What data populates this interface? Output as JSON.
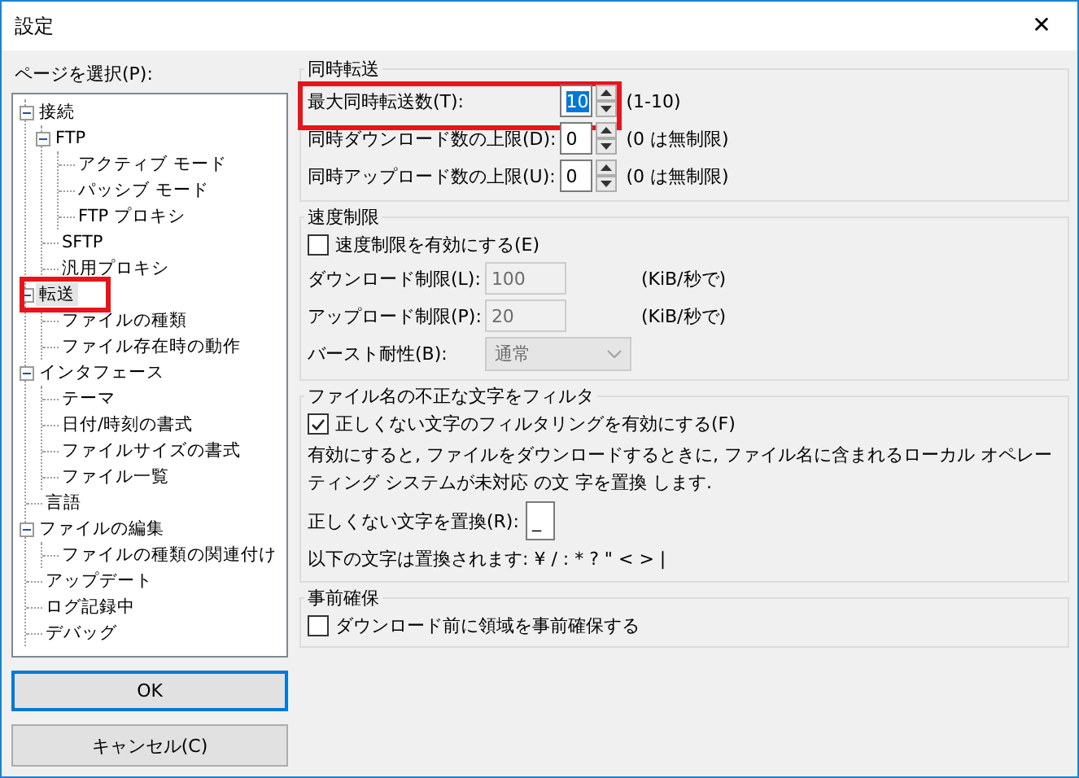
{
  "window": {
    "title": "設定",
    "close": "✕"
  },
  "sidebar": {
    "label": "ページを選択(P):",
    "tree": [
      {
        "label": "接続",
        "expanded": true,
        "selected": false,
        "highlighted": false,
        "children": [
          {
            "label": "FTP",
            "expanded": true,
            "selected": false,
            "highlighted": false,
            "children": [
              {
                "label": "アクティブ モード",
                "selected": false,
                "highlighted": false
              },
              {
                "label": "パッシブ モード",
                "selected": false,
                "highlighted": false
              },
              {
                "label": "FTP プロキシ",
                "selected": false,
                "highlighted": false
              }
            ]
          },
          {
            "label": "SFTP",
            "selected": false,
            "highlighted": false
          },
          {
            "label": "汎用プロキシ",
            "selected": false,
            "highlighted": false
          }
        ]
      },
      {
        "label": "転送",
        "expanded": true,
        "selected": true,
        "highlighted": true,
        "children": [
          {
            "label": "ファイルの種類",
            "selected": false,
            "highlighted": false
          },
          {
            "label": "ファイル存在時の動作",
            "selected": false,
            "highlighted": false
          }
        ]
      },
      {
        "label": "インタフェース",
        "expanded": true,
        "selected": false,
        "highlighted": false,
        "children": [
          {
            "label": "テーマ",
            "selected": false,
            "highlighted": false
          },
          {
            "label": "日付/時刻の書式",
            "selected": false,
            "highlighted": false
          },
          {
            "label": "ファイルサイズの書式",
            "selected": false,
            "highlighted": false
          },
          {
            "label": "ファイル一覧",
            "selected": false,
            "highlighted": false
          }
        ]
      },
      {
        "label": "言語",
        "selected": false,
        "highlighted": false
      },
      {
        "label": "ファイルの編集",
        "expanded": true,
        "selected": false,
        "highlighted": false,
        "children": [
          {
            "label": "ファイルの種類の関連付け",
            "selected": false,
            "highlighted": false
          }
        ]
      },
      {
        "label": "アップデート",
        "selected": false,
        "highlighted": false
      },
      {
        "label": "ログ記録中",
        "selected": false,
        "highlighted": false
      },
      {
        "label": "デバッグ",
        "selected": false,
        "highlighted": false
      }
    ]
  },
  "buttons": [
    {
      "label": "OK",
      "default": true
    },
    {
      "label": "キャンセル(C)",
      "default": false
    }
  ],
  "sections": [
    {
      "title": "同時転送",
      "rows": [
        {
          "kind": "spin",
          "label": "最大同時転送数(T):",
          "value": "10",
          "hint": "(1-10)",
          "focused": true,
          "highlighted": true
        },
        {
          "kind": "spin",
          "label": "同時ダウンロード数の上限(D):",
          "value": "0",
          "hint": "(0 は無制限)",
          "focused": false,
          "highlighted": false
        },
        {
          "kind": "spin",
          "label": "同時アップロード数の上限(U):",
          "value": "0",
          "hint": "(0 は無制限)",
          "focused": false,
          "highlighted": false
        }
      ]
    },
    {
      "title": "速度制限",
      "rows": [
        {
          "kind": "checkbox",
          "label": "速度制限を有効にする(E)",
          "checked": false
        },
        {
          "kind": "field",
          "label": "ダウンロード制限(L):",
          "value": "100",
          "unit": "(KiB/秒で)",
          "disabled": true
        },
        {
          "kind": "field",
          "label": "アップロード制限(P):",
          "value": "20",
          "unit": "(KiB/秒で)",
          "disabled": true
        },
        {
          "kind": "select",
          "label": "バースト耐性(B):",
          "value": "通常",
          "disabled": true
        }
      ]
    },
    {
      "title": "ファイル名の不正な文字をフィルタ",
      "rows": [
        {
          "kind": "checkbox",
          "label": "正しくない文字のフィルタリングを有効にする(F)",
          "checked": true
        },
        {
          "kind": "text",
          "text": "有効にすると, ファイルをダウンロードするときに, ファイル名に含まれるローカル オペレーティング システムが未対応 の文 字を置換 します."
        },
        {
          "kind": "small_field",
          "label": "正しくない文字を置換(R):",
          "value": "_"
        },
        {
          "kind": "text",
          "text": "以下の文字は置換されます: ¥ / : * ? \" < > |"
        }
      ]
    },
    {
      "title": "事前確保",
      "rows": [
        {
          "kind": "checkbox",
          "label": "ダウンロード前に領域を事前確保する",
          "checked": false
        }
      ]
    }
  ]
}
